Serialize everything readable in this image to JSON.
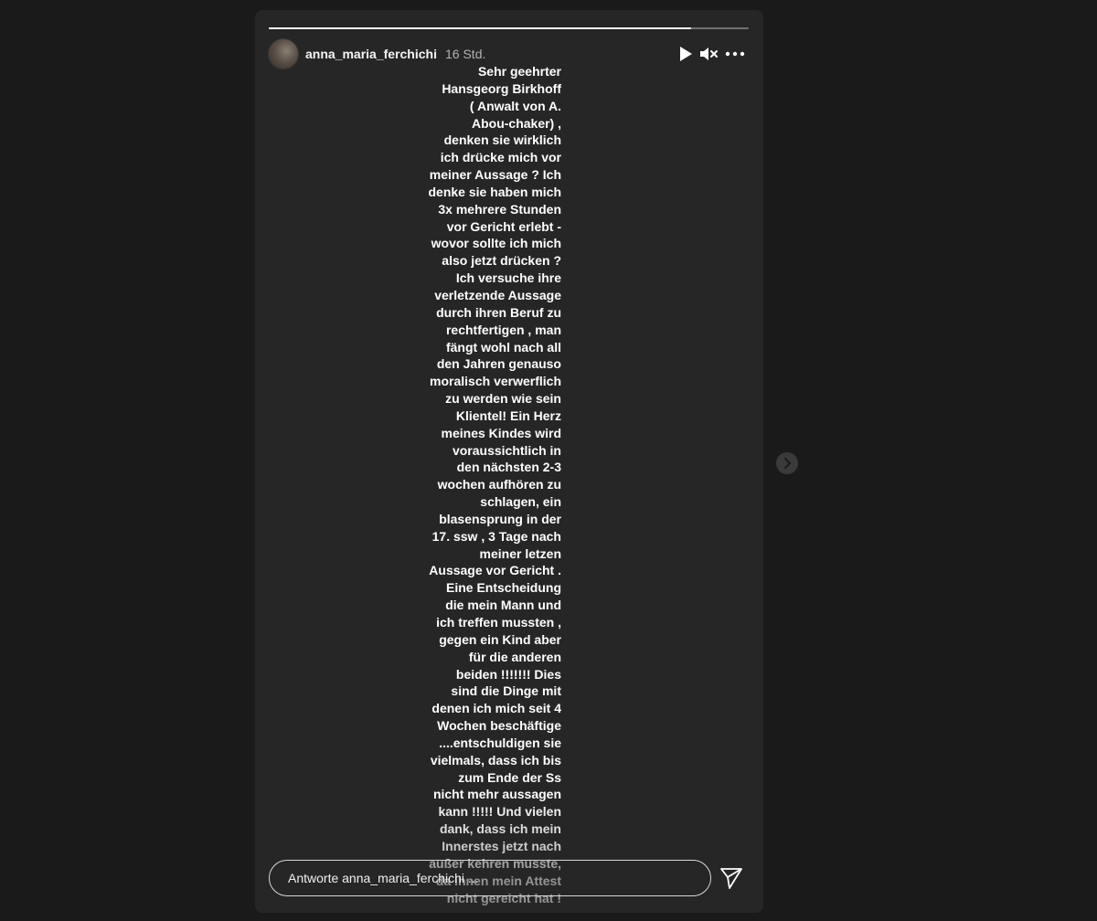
{
  "story": {
    "progress": 0.88,
    "username": "anna_maria_ferchichi",
    "time": "16 Std.",
    "controls": [
      "play-icon",
      "mute-icon",
      "more-icon"
    ],
    "text": "Sehr geehrter\nHansgeorg Birkhoff\n( Anwalt  von A.\nAbou-chaker) ,\ndenken sie wirklich\nich drücke mich vor\nmeiner Aussage ? Ich\ndenke sie haben mich\n3x mehrere Stunden\nvor Gericht erlebt -\nwovor sollte ich mich\nalso jetzt drücken ?\nIch versuche ihre\nverletzende Aussage\ndurch ihren Beruf zu\nrechtfertigen , man\nfängt wohl nach all\nden Jahren genauso\nmoralisch verwerflich\nzu werden  wie sein\nKlientel!  Ein Herz\nmeines Kindes wird\nvoraussichtlich in\nden nächsten 2-3\nwochen aufhören zu\nschlagen,  ein\nblasensprung in der\n17. ssw , 3 Tage nach\nmeiner letzen\nAussage vor Gericht .\nEine Entscheidung\ndie mein Mann und\nich treffen mussten ,\ngegen ein Kind aber\nfür die anderen\nbeiden !!!!!!! Dies\nsind die Dinge mit\ndenen ich  mich seit 4\nWochen beschäftige\n....entschuldigen sie\nvielmals, dass ich  bis\nzum Ende der Ss\nnicht mehr aussagen\nkann !!!!! Und vielen\ndank, dass ich mein\nInnerstes jetzt nach\naußer kehren musste,\nda ihnen mein Attest\nnicht gereicht hat !"
  },
  "reply": {
    "placeholder": "Antworte anna_maria_ferchichi ..."
  },
  "icons": {
    "send": "send-icon",
    "next": "chevron-right-icon"
  }
}
